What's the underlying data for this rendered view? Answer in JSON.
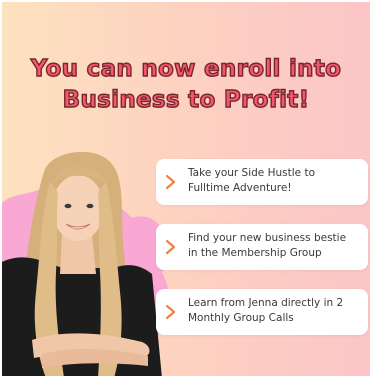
{
  "headline": {
    "line1": "You can now enroll into",
    "line2": "Business to Profit!"
  },
  "bullets": [
    {
      "icon": "chevron-right-icon",
      "line1": "Take your Side Hustle to",
      "line2": "Fulltime Adventure!"
    },
    {
      "icon": "chevron-right-icon",
      "line1": "Find your new business bestie",
      "line2": "in the Membership Group"
    },
    {
      "icon": "chevron-right-icon",
      "line1": "Learn from Jenna directly in 2",
      "line2": "Monthly Group Calls"
    }
  ],
  "colors": {
    "headline_fill": "#f15a6b",
    "headline_outline": "#7a2530",
    "chevron": "#f2804a",
    "blob": "#f9a7d3",
    "bg_left": "#fde2bf",
    "bg_right": "#fcc5c8"
  }
}
